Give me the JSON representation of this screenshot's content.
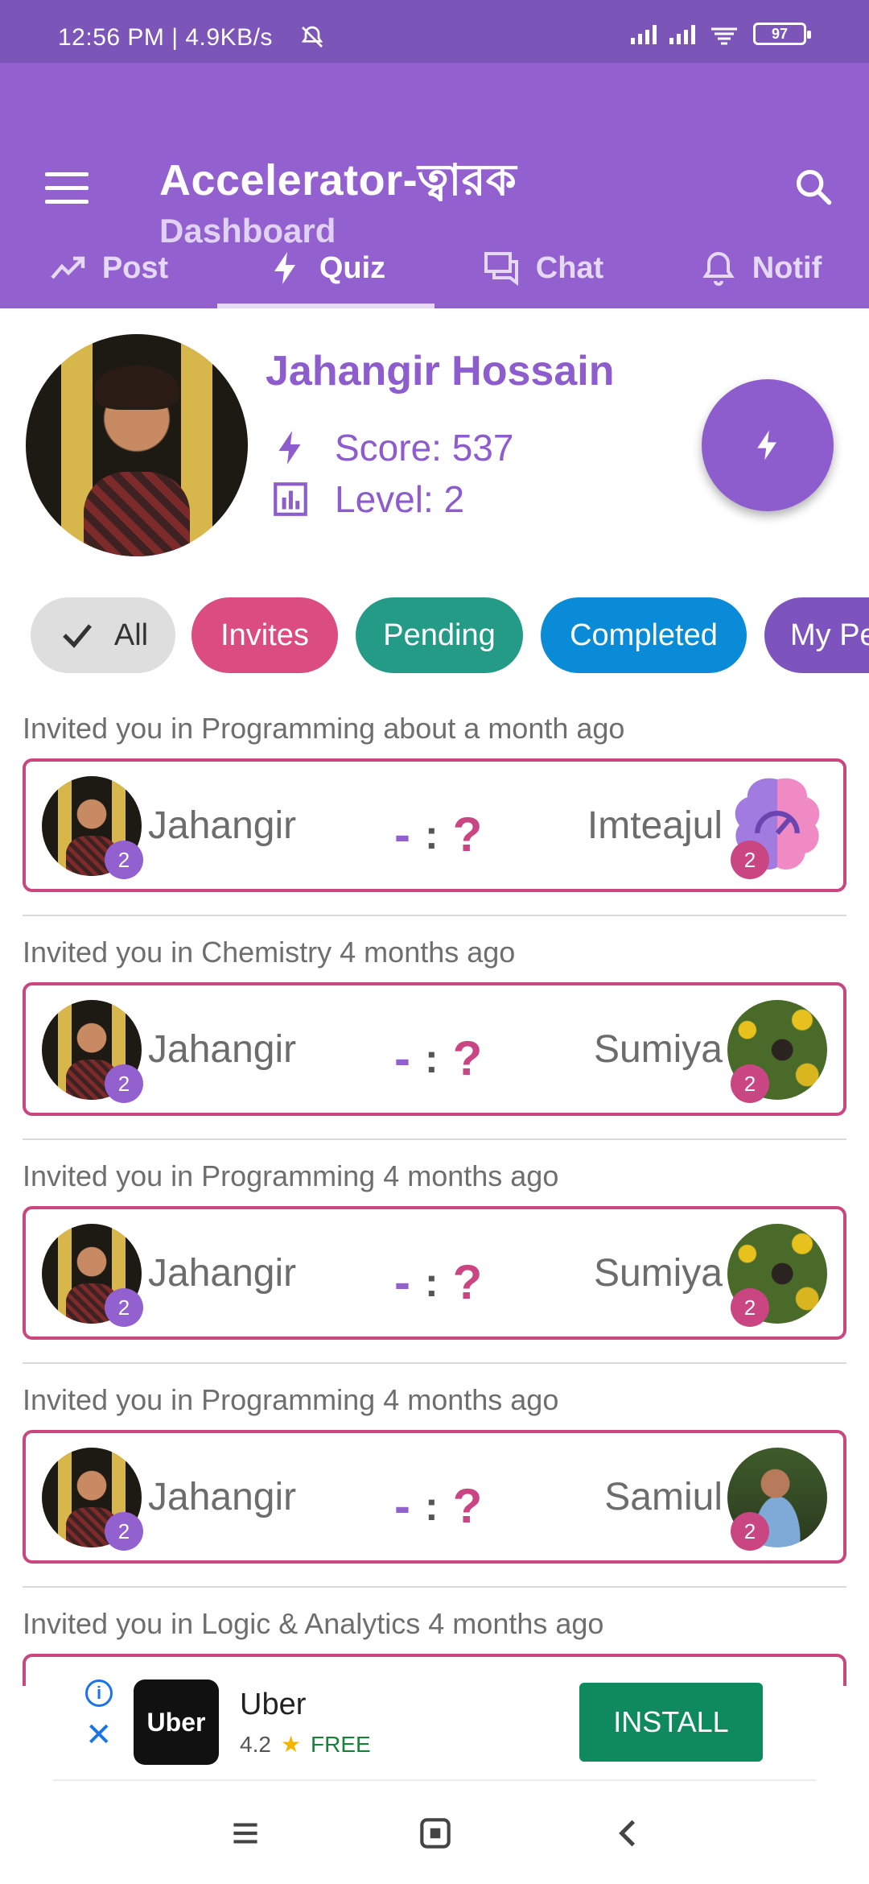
{
  "status_bar": {
    "time_speed": "12:56 PM | 4.9KB/s",
    "battery": "97",
    "icons": [
      "mute-bell-icon",
      "signal-icon",
      "signal-icon",
      "wifi-icon",
      "battery-icon"
    ]
  },
  "app_bar": {
    "title": "Accelerator-ত্বারক",
    "subtitle": "Dashboard",
    "icons": [
      "menu-icon",
      "search-icon"
    ],
    "colors": {
      "primary": "#9360cf",
      "status": "#7b55b8"
    }
  },
  "tabs": [
    {
      "label": "Post",
      "icon": "trending-icon",
      "active": false
    },
    {
      "label": "Quiz",
      "icon": "bolt-icon",
      "active": true
    },
    {
      "label": "Chat",
      "icon": "chat-icon",
      "active": false
    },
    {
      "label": "Notif",
      "icon": "bell-icon",
      "active": false
    }
  ],
  "profile": {
    "name": "Jahangir Hossain",
    "score": "Score: 537",
    "level": "Level: 2"
  },
  "filters": [
    {
      "label": "All",
      "color": "#dedede",
      "selected": true
    },
    {
      "label": "Invites",
      "color": "#db4c80"
    },
    {
      "label": "Pending",
      "color": "#249b86"
    },
    {
      "label": "Completed",
      "color": "#0a8bd8"
    },
    {
      "label": "My Pe",
      "color": "#7d54bd"
    }
  ],
  "invites": [
    {
      "caption": "Invited you in Programming about a month ago",
      "me": "Jahangir",
      "me_level": "2",
      "opponent": "Imteajul",
      "opp_level": "2",
      "score_left": "-",
      "sep": ":",
      "score_right": "?",
      "avatar": "brain"
    },
    {
      "caption": "Invited you in Chemistry 4 months ago",
      "me": "Jahangir",
      "me_level": "2",
      "opponent": "Sumiya",
      "opp_level": "2",
      "score_left": "-",
      "sep": ":",
      "score_right": "?",
      "avatar": "sun"
    },
    {
      "caption": "Invited you in Programming 4 months ago",
      "me": "Jahangir",
      "me_level": "2",
      "opponent": "Sumiya",
      "opp_level": "2",
      "score_left": "-",
      "sep": ":",
      "score_right": "?",
      "avatar": "sun"
    },
    {
      "caption": "Invited you in Programming 4 months ago",
      "me": "Jahangir",
      "me_level": "2",
      "opponent": "Samiul",
      "opp_level": "2",
      "score_left": "-",
      "sep": ":",
      "score_right": "?",
      "avatar": "sam"
    },
    {
      "caption": "Invited you in Logic & Analytics 4 months ago"
    }
  ],
  "ad": {
    "logo": "Uber",
    "name": "Uber",
    "rating": "4.2",
    "price": "FREE",
    "button": "INSTALL"
  },
  "nav": [
    "recents-icon",
    "home-icon",
    "back-icon"
  ]
}
